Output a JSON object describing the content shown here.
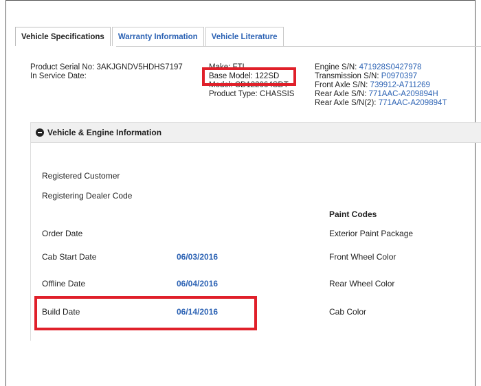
{
  "tabs": [
    {
      "label": "Vehicle Specifications",
      "active": true
    },
    {
      "label": "Warranty Information",
      "active": false
    },
    {
      "label": "Vehicle Literature",
      "active": false
    }
  ],
  "spec": {
    "product_serial_label": "Product Serial No:",
    "product_serial_value": "3AKJGNDV5HDHS7197",
    "in_service_label": "In Service Date:",
    "make_label": "Make:",
    "make_value": "FTL",
    "base_model_label": "Base Model:",
    "base_model_value": "122SD",
    "model_label": "Model:",
    "model_value": "CD122064SDT",
    "product_type_label": "Product Type:",
    "product_type_value": "CHASSIS",
    "engine_label": "Engine S/N:",
    "engine_value": "471928S0427978",
    "transmission_label": "Transmission S/N:",
    "transmission_value": "P0970397",
    "front_axle_label": "Front Axle S/N:",
    "front_axle_value": "739912-A711269",
    "rear_axle_label": "Rear Axle S/N:",
    "rear_axle_value": "771AAC-A209894H",
    "rear_axle2_label": "Rear Axle S/N(2):",
    "rear_axle2_value": "771AAC-A209894T"
  },
  "panel": {
    "title": "Vehicle & Engine Information",
    "registered_customer_label": "Registered Customer",
    "registering_dealer_label": "Registering Dealer Code",
    "paint_codes_heading": "Paint Codes",
    "order_date_label": "Order Date",
    "exterior_paint_label": "Exterior Paint Package",
    "cab_start_label": "Cab Start Date",
    "cab_start_value": "06/03/2016",
    "front_wheel_label": "Front Wheel Color",
    "offline_label": "Offline Date",
    "offline_value": "06/04/2016",
    "rear_wheel_label": "Rear Wheel Color",
    "build_date_label": "Build Date",
    "build_date_value": "06/14/2016",
    "cab_color_label": "Cab Color"
  },
  "colors": {
    "link": "#2d63b4",
    "highlight": "#e0202a"
  }
}
